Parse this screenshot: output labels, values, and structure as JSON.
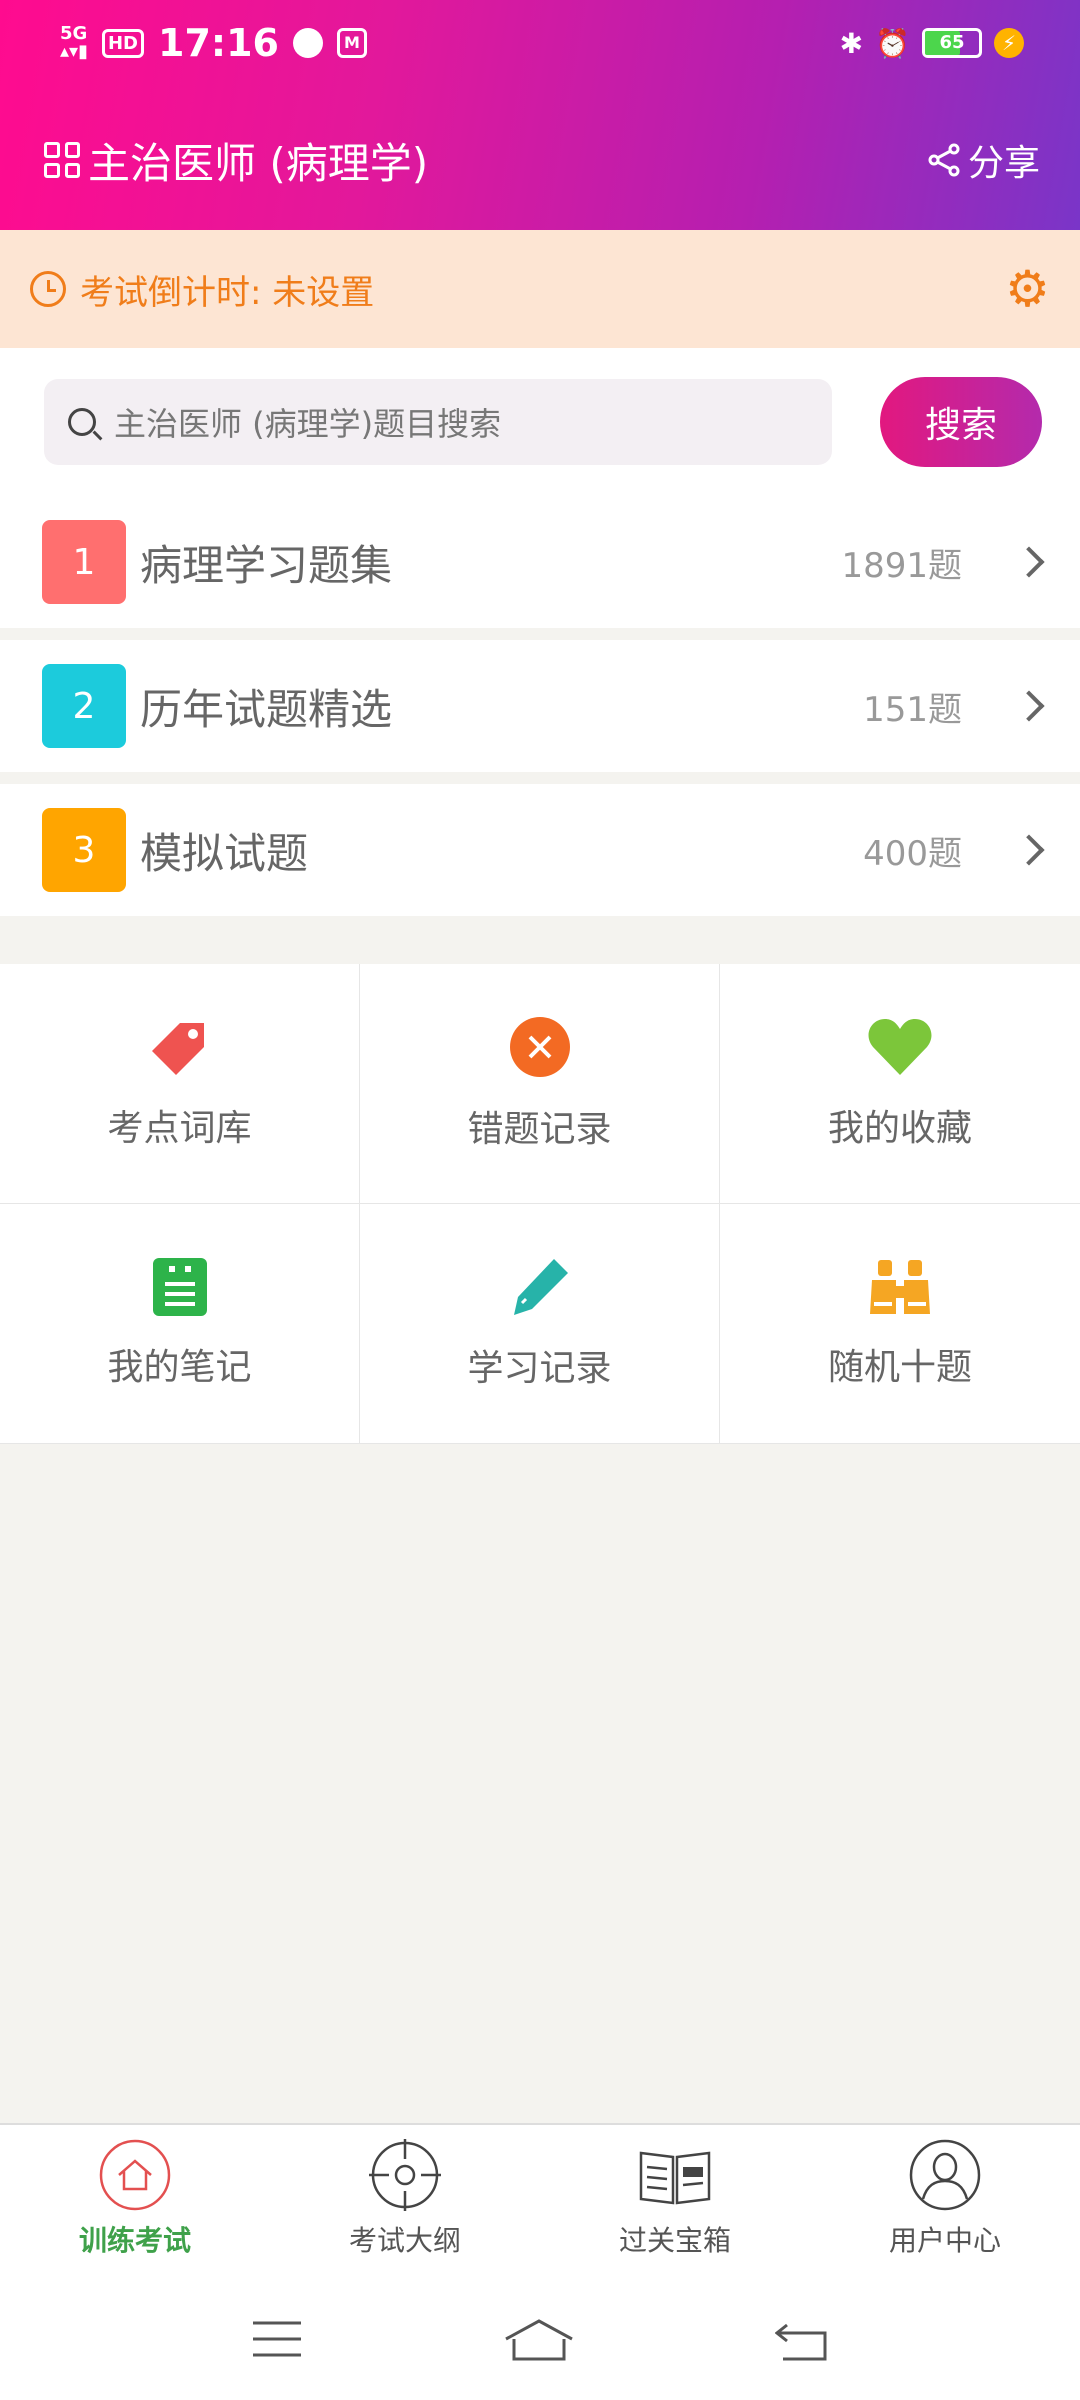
{
  "status_bar": {
    "network": "5G",
    "hd": "HD",
    "time": "17:16",
    "battery": "65",
    "battery_level": 0.65
  },
  "header": {
    "title": "主治医师 (病理学)",
    "share_label": "分享"
  },
  "countdown": {
    "text": "考试倒计时: 未设置"
  },
  "search": {
    "placeholder": "主治医师 (病理学)题目搜索",
    "button_label": "搜索"
  },
  "categories": [
    {
      "index": "1",
      "name": "病理学习题集",
      "count": "1891题",
      "color": "#ff6f6f"
    },
    {
      "index": "2",
      "name": "历年试题精选",
      "count": "151题",
      "color": "#1ccbdc"
    },
    {
      "index": "3",
      "name": "模拟试题",
      "count": "400题",
      "color": "#ffa500"
    }
  ],
  "tools": [
    {
      "label": "考点词库",
      "icon": "tag-icon",
      "color": "#ef5350"
    },
    {
      "label": "错题记录",
      "icon": "error-circle-icon",
      "color": "#f36a23"
    },
    {
      "label": "我的收藏",
      "icon": "heart-icon",
      "color": "#7cc63a"
    },
    {
      "label": "我的笔记",
      "icon": "notebook-icon",
      "color": "#2db34a"
    },
    {
      "label": "学习记录",
      "icon": "pencil-icon",
      "color": "#27b3a9"
    },
    {
      "label": "随机十题",
      "icon": "binoculars-icon",
      "color": "#f5a623"
    }
  ],
  "bottom_nav": [
    {
      "label": "训练考试",
      "icon": "home-icon",
      "active": true
    },
    {
      "label": "考试大纲",
      "icon": "target-icon",
      "active": false
    },
    {
      "label": "过关宝箱",
      "icon": "book-icon",
      "active": false
    },
    {
      "label": "用户中心",
      "icon": "user-icon",
      "active": false
    }
  ],
  "colors": {
    "accent": "#e2187f",
    "active_nav": "#3fa14a",
    "countdown": "#f07d1a"
  }
}
